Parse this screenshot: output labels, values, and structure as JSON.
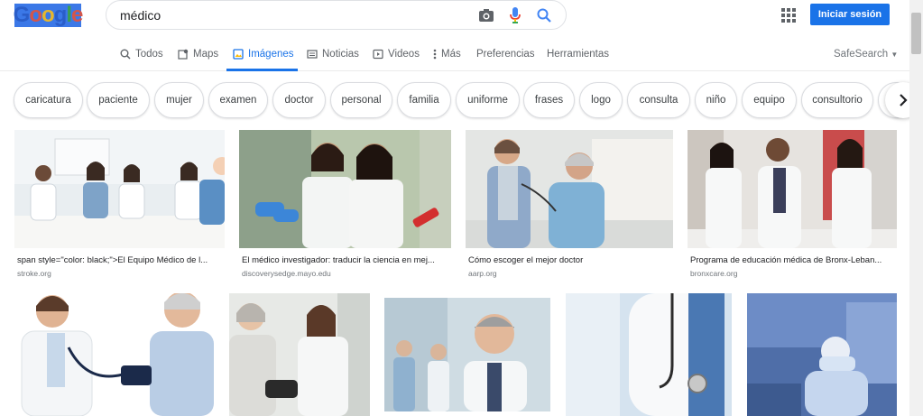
{
  "header": {
    "search_query": "médico",
    "signin_label": "Iniciar sesión"
  },
  "tabs": [
    {
      "label": "Todos",
      "icon": "search-icon"
    },
    {
      "label": "Maps",
      "icon": "map-icon"
    },
    {
      "label": "Imágenes",
      "icon": "image-icon",
      "active": true
    },
    {
      "label": "Noticias",
      "icon": "news-icon"
    },
    {
      "label": "Videos",
      "icon": "video-icon"
    },
    {
      "label": "Más",
      "icon": "more-vert-icon"
    },
    {
      "label": "Preferencias"
    },
    {
      "label": "Herramientas"
    }
  ],
  "safesearch_label": "SafeSearch",
  "chips": [
    "caricatura",
    "paciente",
    "mujer",
    "examen",
    "doctor",
    "personal",
    "familia",
    "uniforme",
    "frases",
    "logo",
    "consulta",
    "niño",
    "equipo",
    "consultorio"
  ],
  "results_row1": [
    {
      "caption": "span style=\"color: black;\">El Equipo Médico de l...",
      "source": "stroke.org"
    },
    {
      "caption": "El médico investigador: traducir la ciencia en mej...",
      "source": "discoverysedge.mayo.edu"
    },
    {
      "caption": "Cómo escoger el mejor doctor",
      "source": "aarp.org"
    },
    {
      "caption": "Programa de educación médica de Bronx-Leban...",
      "source": "bronxcare.org"
    }
  ],
  "colors": {
    "accent": "#1a73e8",
    "chip_border": "#dadce0",
    "text_secondary": "#70757a"
  }
}
